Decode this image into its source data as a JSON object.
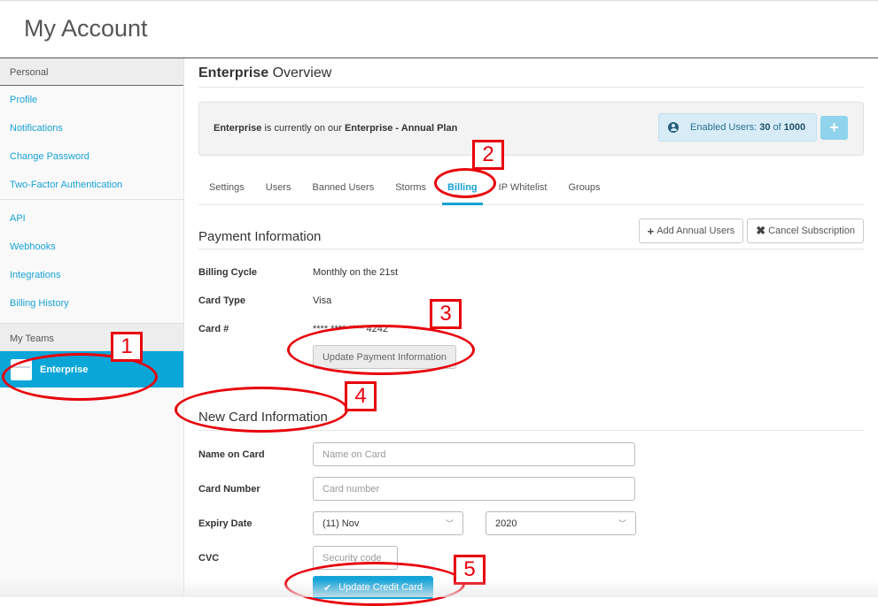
{
  "header": {
    "title": "My Account"
  },
  "sidebar": {
    "personal_heading": "Personal",
    "personal_items": [
      {
        "label": "Profile"
      },
      {
        "label": "Notifications"
      },
      {
        "label": "Change Password"
      },
      {
        "label": "Two-Factor Authentication"
      }
    ],
    "dev_items": [
      {
        "label": "API"
      },
      {
        "label": "Webhooks"
      },
      {
        "label": "Integrations"
      },
      {
        "label": "Billing History"
      }
    ],
    "teams_heading": "My Teams",
    "teams": [
      {
        "label": "Enterprise",
        "active": true
      }
    ]
  },
  "overview": {
    "title_bold": "Enterprise",
    "title_rest": " Overview",
    "plan": {
      "team": "Enterprise",
      "middle": " is currently on our ",
      "plan_name": "Enterprise - Annual Plan"
    },
    "users": {
      "label": "Enabled Users:",
      "enabled": "30",
      "of": "of",
      "total": "1000"
    },
    "add_button": "+"
  },
  "tabs": [
    {
      "label": "Settings",
      "active": false
    },
    {
      "label": "Users",
      "active": false
    },
    {
      "label": "Banned Users",
      "active": false
    },
    {
      "label": "Storms",
      "active": false
    },
    {
      "label": "Billing",
      "active": true
    },
    {
      "label": "IP Whitelist",
      "active": false
    },
    {
      "label": "Groups",
      "active": false
    }
  ],
  "payment": {
    "title": "Payment Information",
    "add_users_label": "Add Annual Users",
    "cancel_label": "Cancel Subscription",
    "rows": [
      {
        "key": "Billing Cycle",
        "value": "Monthly on the 21st"
      },
      {
        "key": "Card Type",
        "value": "Visa"
      },
      {
        "key": "Card #",
        "value": "**** **** **** 4242"
      }
    ],
    "update_button": "Update Payment Information"
  },
  "new_card": {
    "title": "New Card Information",
    "name_label": "Name on Card",
    "name_placeholder": "Name on Card",
    "number_label": "Card Number",
    "number_placeholder": "Card number",
    "expiry_label": "Expiry Date",
    "expiry_month": "(11) Nov",
    "expiry_year": "2020",
    "cvc_label": "CVC",
    "cvc_placeholder": "Security code",
    "submit_label": "Update Credit Card"
  },
  "annotations": [
    "1",
    "2",
    "3",
    "4",
    "5"
  ],
  "colors": {
    "accent": "#17a2d4",
    "annotation": "#e8000b",
    "active_team_bg": "#0aa6d8"
  }
}
